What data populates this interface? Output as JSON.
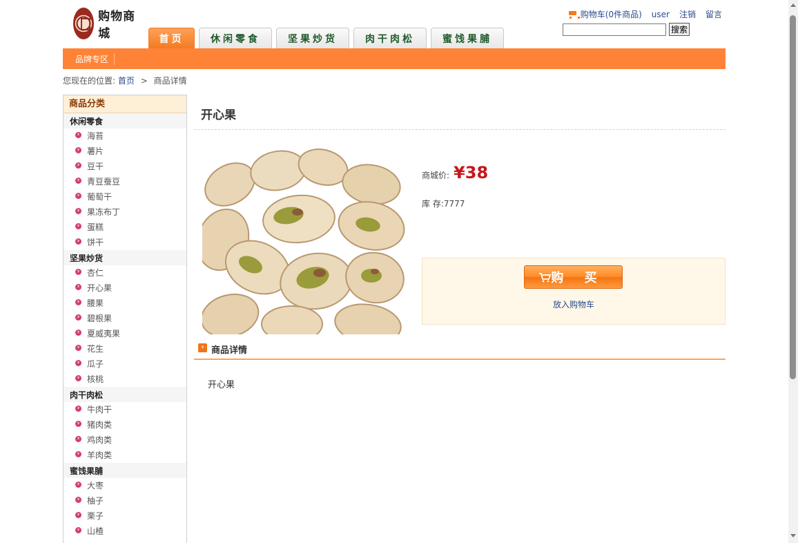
{
  "header": {
    "logo_text": "购物商城",
    "cart_link": "购物车(0件商品)",
    "user_link": "user",
    "logout_link": "注销",
    "message_link": "留言",
    "search_placeholder": "",
    "search_button": "搜索"
  },
  "tabs": [
    {
      "label": "首页",
      "active": true
    },
    {
      "label": "休闲零食",
      "active": false
    },
    {
      "label": "坚果炒货",
      "active": false
    },
    {
      "label": "肉干肉松",
      "active": false
    },
    {
      "label": "蜜饯果脯",
      "active": false
    }
  ],
  "navbar": {
    "brand_zone": "品牌专区"
  },
  "breadcrumb": {
    "prefix": "您现在的位置:",
    "home": "首页",
    "separator": ">",
    "current": "商品详情"
  },
  "sidebar": {
    "title": "商品分类",
    "categories": [
      {
        "name": "休闲零食",
        "items": [
          "海苔",
          "薯片",
          "豆干",
          "青豆蚕豆",
          "葡萄干",
          "果冻布丁",
          "蛋糕",
          "饼干"
        ]
      },
      {
        "name": "坚果炒货",
        "items": [
          "杏仁",
          "开心果",
          "腰果",
          "碧根果",
          "夏威夷果",
          "花生",
          "瓜子",
          "核桃"
        ]
      },
      {
        "name": "肉干肉松",
        "items": [
          "牛肉干",
          "猪肉类",
          "鸡肉类",
          "羊肉类"
        ]
      },
      {
        "name": "蜜饯果脯",
        "items": [
          "大枣",
          "柚子",
          "栗子",
          "山楂"
        ]
      }
    ]
  },
  "product": {
    "name": "开心果",
    "price_label": "商城价:",
    "price": "¥38",
    "stock": "库 存:7777",
    "buy_button": "购 买",
    "add_to_cart": "放入购物车",
    "image_icon": "pistachio-photo"
  },
  "detail": {
    "title": "商品详情",
    "body": "开心果"
  },
  "colors": {
    "accent": "#ff8336",
    "price": "#c7161b",
    "link": "#2a4a8a",
    "tab_text": "#1f5a2a"
  }
}
